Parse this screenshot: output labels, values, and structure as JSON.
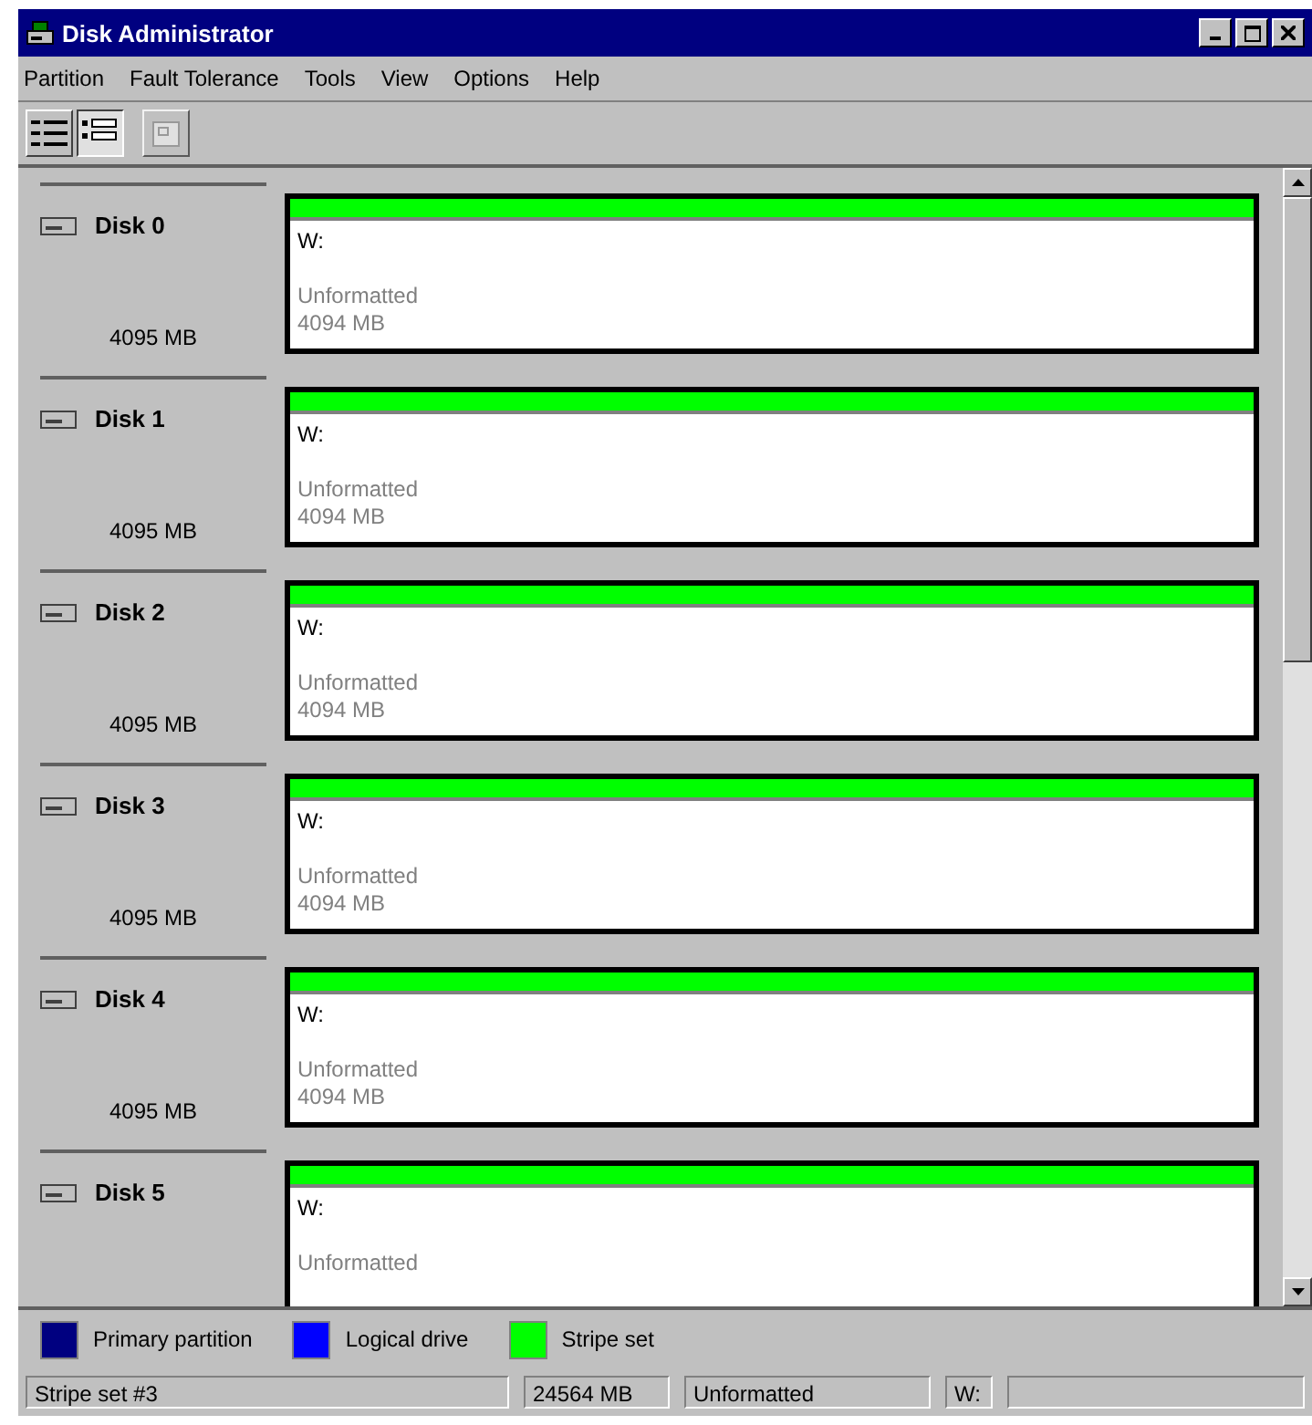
{
  "window": {
    "title": "Disk Administrator"
  },
  "menu": [
    "Partition",
    "Fault Tolerance",
    "Tools",
    "View",
    "Options",
    "Help"
  ],
  "toolbar": [
    {
      "kind": "volumes",
      "selected": false,
      "disabled": false
    },
    {
      "kind": "disks",
      "selected": true,
      "disabled": false
    },
    {
      "kind": "properties",
      "selected": false,
      "disabled": true
    }
  ],
  "disks": [
    {
      "name": "Disk 0",
      "size": "4095 MB",
      "partition": {
        "drive": "W:",
        "status": "Unformatted",
        "size": "4094 MB",
        "color": "#00ff00",
        "selected": true
      }
    },
    {
      "name": "Disk 1",
      "size": "4095 MB",
      "partition": {
        "drive": "W:",
        "status": "Unformatted",
        "size": "4094 MB",
        "color": "#00ff00",
        "selected": true
      }
    },
    {
      "name": "Disk 2",
      "size": "4095 MB",
      "partition": {
        "drive": "W:",
        "status": "Unformatted",
        "size": "4094 MB",
        "color": "#00ff00",
        "selected": true
      }
    },
    {
      "name": "Disk 3",
      "size": "4095 MB",
      "partition": {
        "drive": "W:",
        "status": "Unformatted",
        "size": "4094 MB",
        "color": "#00ff00",
        "selected": true
      }
    },
    {
      "name": "Disk 4",
      "size": "4095 MB",
      "partition": {
        "drive": "W:",
        "status": "Unformatted",
        "size": "4094 MB",
        "color": "#00ff00",
        "selected": true
      }
    },
    {
      "name": "Disk 5",
      "partition": {
        "drive": "W:",
        "status": "Unformatted",
        "color": "#00ff00",
        "selected": true
      }
    }
  ],
  "legend": [
    {
      "label": "Primary partition",
      "color": "#000080"
    },
    {
      "label": "Logical drive",
      "color": "#0000ff"
    },
    {
      "label": "Stripe set",
      "color": "#00ff00"
    }
  ],
  "status_bar": [
    "Stripe set #3",
    "24564 MB",
    "Unformatted",
    "W:"
  ]
}
